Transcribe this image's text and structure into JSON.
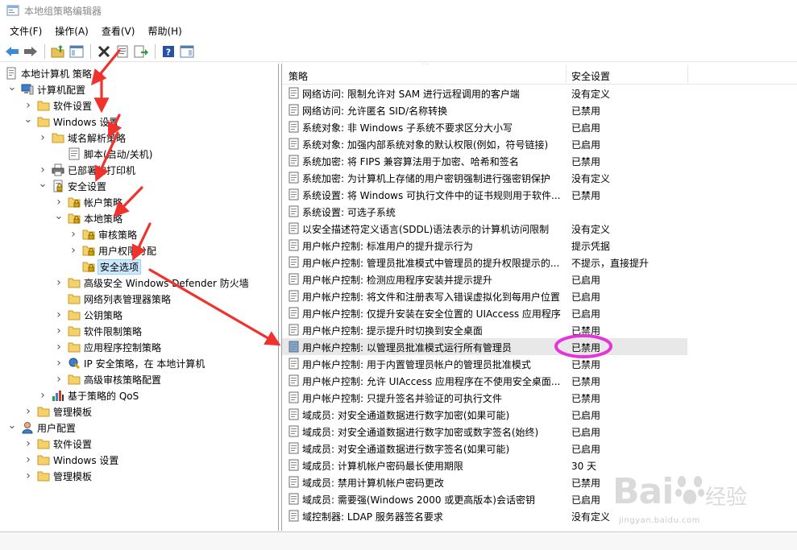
{
  "window": {
    "title": "本地组策略编辑器"
  },
  "menubar": {
    "items": [
      "文件(F)",
      "操作(A)",
      "查看(V)",
      "帮助(H)"
    ]
  },
  "tree": {
    "items": [
      {
        "label": "本地计算机 策略",
        "icon": "computer-policy-icon",
        "twisty": ""
      },
      {
        "label": "计算机配置",
        "icon": "computer-icon",
        "twisty": "expanded"
      },
      {
        "label": "软件设置",
        "icon": "folder-icon",
        "twisty": "collapsed"
      },
      {
        "label": "Windows 设置",
        "icon": "folder-icon",
        "twisty": "expanded"
      },
      {
        "label": "域名解析策略",
        "icon": "folder-icon",
        "twisty": "collapsed"
      },
      {
        "label": "脚本(启动/关机)",
        "icon": "script-icon",
        "twisty": ""
      },
      {
        "label": "已部署的打印机",
        "icon": "printer-icon",
        "twisty": "collapsed"
      },
      {
        "label": "安全设置",
        "icon": "security-icon",
        "twisty": "expanded"
      },
      {
        "label": "帐户策略",
        "icon": "lock-folder-icon",
        "twisty": "collapsed"
      },
      {
        "label": "本地策略",
        "icon": "lock-folder-icon",
        "twisty": "expanded"
      },
      {
        "label": "审核策略",
        "icon": "lock-folder-icon",
        "twisty": "collapsed"
      },
      {
        "label": "用户权限分配",
        "icon": "lock-folder-icon",
        "twisty": "collapsed"
      },
      {
        "label": "安全选项",
        "icon": "lock-folder-icon",
        "twisty": ""
      },
      {
        "label": "高级安全 Windows Defender 防火墙",
        "icon": "folder-icon",
        "twisty": "collapsed"
      },
      {
        "label": "网络列表管理器策略",
        "icon": "folder-icon",
        "twisty": ""
      },
      {
        "label": "公钥策略",
        "icon": "folder-icon",
        "twisty": "collapsed"
      },
      {
        "label": "软件限制策略",
        "icon": "folder-icon",
        "twisty": "collapsed"
      },
      {
        "label": "应用程序控制策略",
        "icon": "folder-icon",
        "twisty": "collapsed"
      },
      {
        "label": "IP 安全策略，在 本地计算机",
        "icon": "ipsec-icon",
        "twisty": "collapsed"
      },
      {
        "label": "高级审核策略配置",
        "icon": "folder-icon",
        "twisty": "collapsed"
      },
      {
        "label": "基于策略的 QoS",
        "icon": "chart-icon",
        "twisty": "collapsed"
      },
      {
        "label": "管理模板",
        "icon": "folder-icon",
        "twisty": "collapsed"
      },
      {
        "label": "用户配置",
        "icon": "user-icon",
        "twisty": "expanded"
      },
      {
        "label": "软件设置",
        "icon": "folder-icon",
        "twisty": "collapsed"
      },
      {
        "label": "Windows 设置",
        "icon": "folder-icon",
        "twisty": "collapsed"
      },
      {
        "label": "管理模板",
        "icon": "folder-icon",
        "twisty": "collapsed"
      }
    ]
  },
  "list": {
    "header": {
      "policy": "策略",
      "setting": "安全设置"
    },
    "rows": [
      {
        "policy": "网络访问: 限制允许对 SAM 进行远程调用的客户端",
        "setting": "没有定义"
      },
      {
        "policy": "网络访问: 允许匿名 SID/名称转换",
        "setting": "已禁用"
      },
      {
        "policy": "系统对象: 非 Windows 子系统不要求区分大小写",
        "setting": "已启用"
      },
      {
        "policy": "系统对象: 加强内部系统对象的默认权限(例如，符号链接)",
        "setting": "已启用"
      },
      {
        "policy": "系统加密: 将 FIPS 兼容算法用于加密、哈希和签名",
        "setting": "已禁用"
      },
      {
        "policy": "系统加密: 为计算机上存储的用户密钥强制进行强密钥保护",
        "setting": "没有定义"
      },
      {
        "policy": "系统设置: 将 Windows 可执行文件中的证书规则用于软件...",
        "setting": "已禁用"
      },
      {
        "policy": "系统设置: 可选子系统",
        "setting": ""
      },
      {
        "policy": "以安全描述符定义语言(SDDL)语法表示的计算机访问限制",
        "setting": "没有定义"
      },
      {
        "policy": "用户帐户控制: 标准用户的提升提示行为",
        "setting": "提示凭据"
      },
      {
        "policy": "用户帐户控制: 管理员批准模式中管理员的提升权限提示的...",
        "setting": "不提示，直接提升"
      },
      {
        "policy": "用户帐户控制: 检测应用程序安装并提示提升",
        "setting": "已启用"
      },
      {
        "policy": "用户帐户控制: 将文件和注册表写入错误虚拟化到每用户位置",
        "setting": "已启用"
      },
      {
        "policy": "用户帐户控制: 仅提升安装在安全位置的 UIAccess 应用程序",
        "setting": "已启用"
      },
      {
        "policy": "用户帐户控制: 提示提升时切换到安全桌面",
        "setting": "已禁用"
      },
      {
        "policy": "用户帐户控制: 以管理员批准模式运行所有管理员",
        "setting": "已禁用"
      },
      {
        "policy": "用户帐户控制: 用于内置管理员帐户的管理员批准模式",
        "setting": "已禁用"
      },
      {
        "policy": "用户帐户控制: 允许 UIAccess 应用程序在不使用安全桌面...",
        "setting": "已禁用"
      },
      {
        "policy": "用户帐户控制: 只提升签名并验证的可执行文件",
        "setting": "已禁用"
      },
      {
        "policy": "域成员: 对安全通道数据进行数字加密(如果可能)",
        "setting": "已启用"
      },
      {
        "policy": "域成员: 对安全通道数据进行数字加密或数字签名(始终)",
        "setting": "已启用"
      },
      {
        "policy": "域成员: 对安全通道数据进行数字签名(如果可能)",
        "setting": "已启用"
      },
      {
        "policy": "域成员: 计算机帐户密码最长使用期限",
        "setting": "30 天"
      },
      {
        "policy": "域成员: 禁用计算机帐户密码更改",
        "setting": "已禁用"
      },
      {
        "policy": "域成员: 需要强(Windows 2000 或更高版本)会话密钥",
        "setting": "已启用"
      },
      {
        "policy": "域控制器: LDAP 服务器签名要求",
        "setting": "没有定义"
      }
    ]
  },
  "annotations": {
    "arrow_color": "#f0322d",
    "circle_color": "#e535d8"
  },
  "watermark": {
    "brand": "Bai",
    "brand2": "经验",
    "url": "jingyan.baidu.com"
  }
}
